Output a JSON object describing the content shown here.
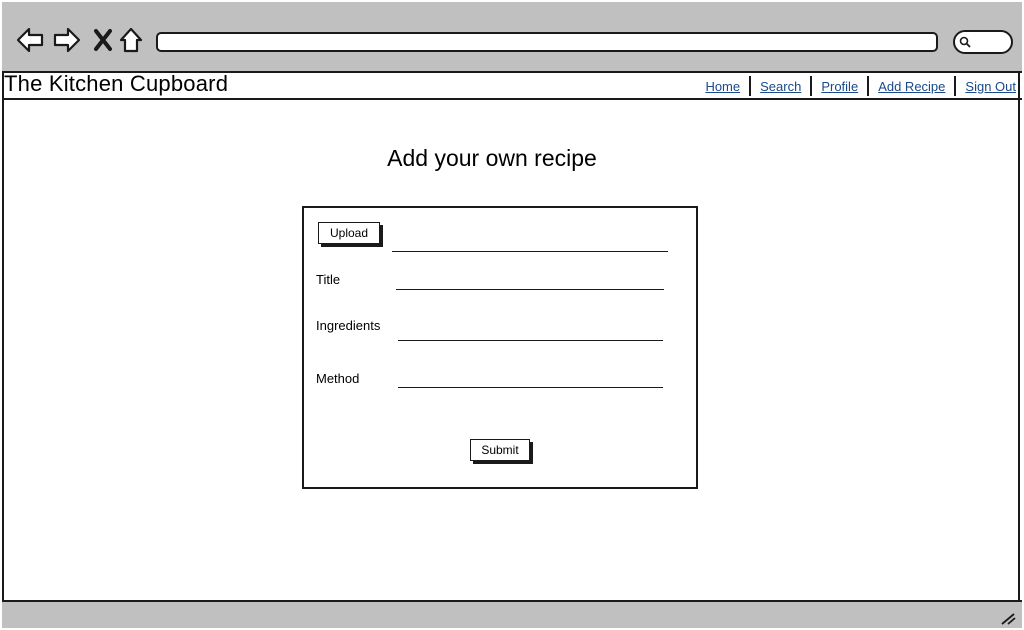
{
  "browser": {
    "icons": [
      "back-icon",
      "forward-icon",
      "close-icon",
      "home-icon",
      "search-icon",
      "resize-grip-icon"
    ],
    "url": ""
  },
  "site": {
    "title": "The Kitchen Cupboard"
  },
  "nav": {
    "items": [
      {
        "label": "Home"
      },
      {
        "label": "Search"
      },
      {
        "label": "Profile"
      },
      {
        "label": "Add Recipe"
      },
      {
        "label": "Sign Out"
      }
    ]
  },
  "page": {
    "heading": "Add your own recipe"
  },
  "form": {
    "upload_label": "Upload",
    "fields": [
      {
        "label": "Title",
        "value": ""
      },
      {
        "label": "Ingredients",
        "value": ""
      },
      {
        "label": "Method",
        "value": ""
      }
    ],
    "submit_label": "Submit"
  },
  "colors": {
    "chrome": "#c0c0c0",
    "link": "#1a4a8a",
    "border": "#1a1a1a"
  }
}
